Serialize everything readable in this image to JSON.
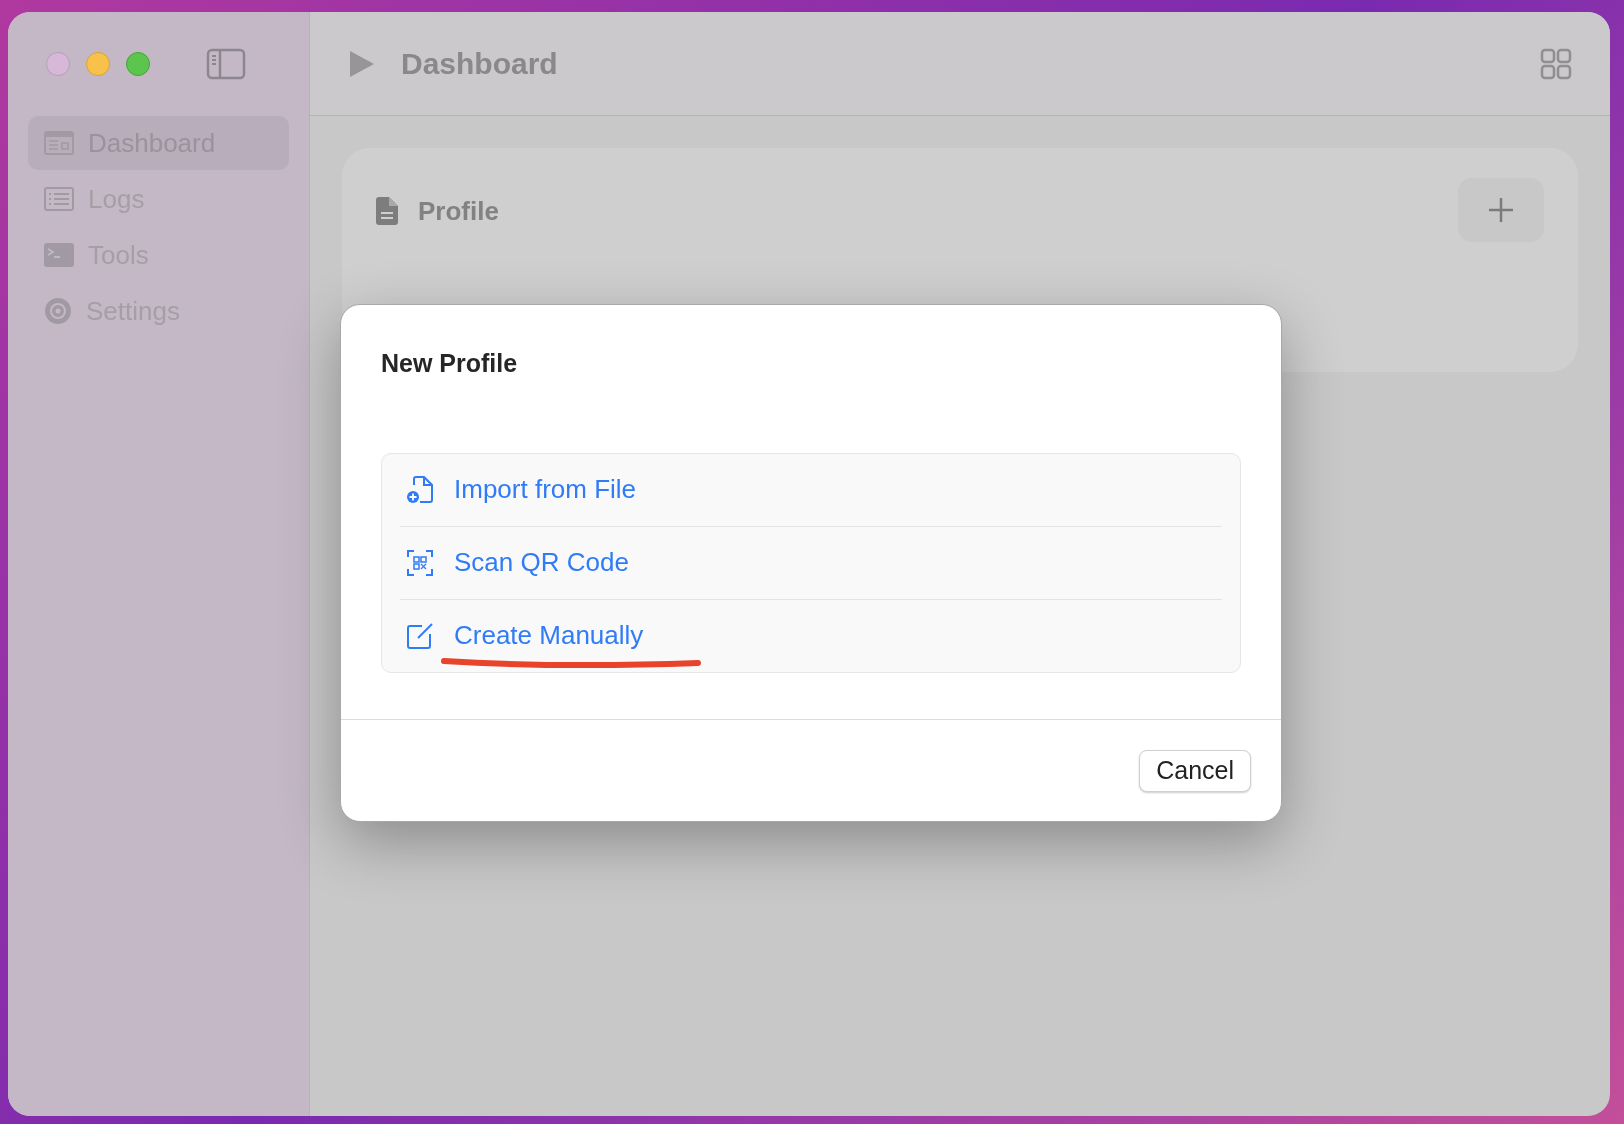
{
  "window": {
    "title": "Dashboard"
  },
  "sidebar": {
    "items": [
      {
        "label": "Dashboard",
        "selected": true
      },
      {
        "label": "Logs",
        "selected": false
      },
      {
        "label": "Tools",
        "selected": false
      },
      {
        "label": "Settings",
        "selected": false
      }
    ]
  },
  "profile_card": {
    "title": "Profile"
  },
  "dialog": {
    "title": "New Profile",
    "options": [
      {
        "label": "Import from File",
        "underlined": false
      },
      {
        "label": "Scan QR Code",
        "underlined": false
      },
      {
        "label": "Create Manually",
        "underlined": true
      }
    ],
    "buttons": [
      "Cancel"
    ]
  }
}
